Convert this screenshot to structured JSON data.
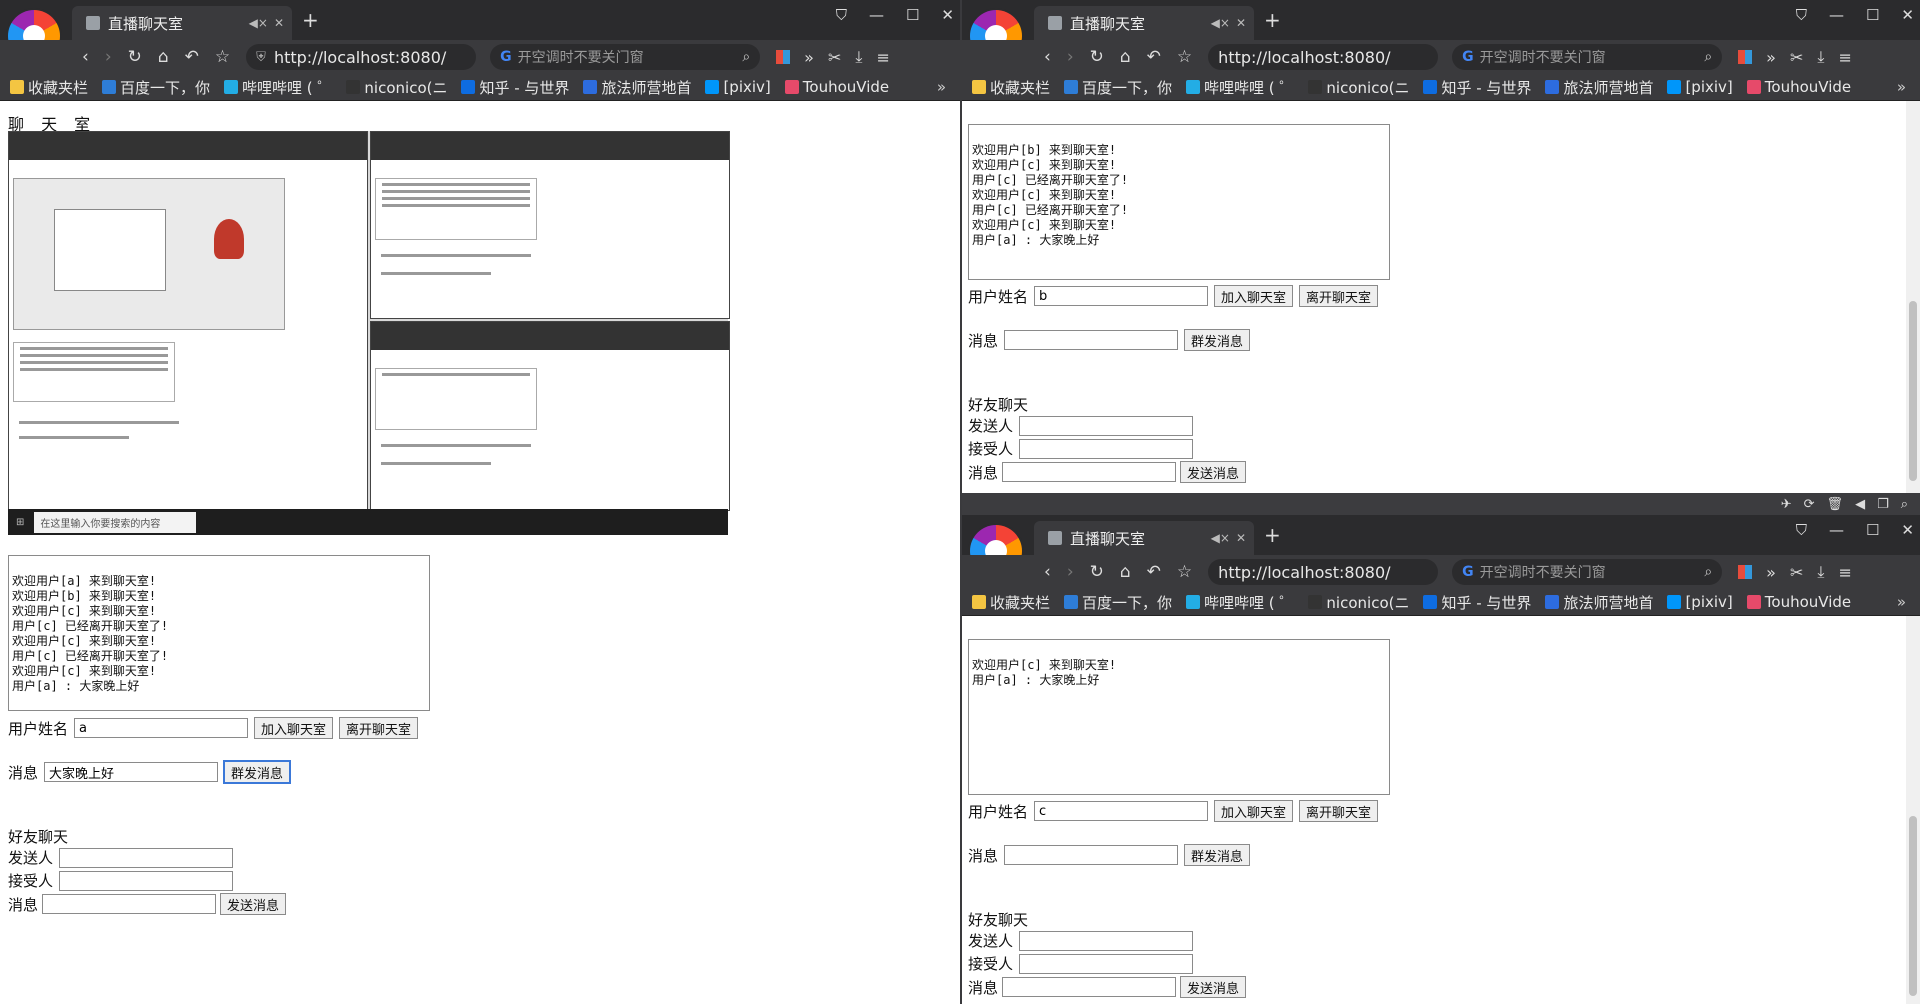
{
  "browser": {
    "tab_title": "直播聊天室",
    "mute_icon": "speaker-mute-icon",
    "url": "http://localhost:8080/",
    "search_placeholder": "开空调时不要关门窗",
    "bookmarks": [
      {
        "label": "收藏夹栏",
        "color": "#f4c542"
      },
      {
        "label": "百度一下，你",
        "color": "#2e7dd7"
      },
      {
        "label": "哔哩哔哩 ( ゜",
        "color": "#23ade5"
      },
      {
        "label": "niconico(ニ",
        "color": "#333333"
      },
      {
        "label": "知乎 - 与世界",
        "color": "#0e6ce0"
      },
      {
        "label": "旅法师营地首",
        "color": "#2d6cdf"
      },
      {
        "label": "[pixiv]",
        "color": "#0096fa"
      },
      {
        "label": "TouhouVide",
        "color": "#e64a6a"
      }
    ]
  },
  "left": {
    "page_title": "聊 天 室",
    "embedded_taskbar_search": "在这里输入你要搜索的内容",
    "chat_log": "欢迎用户[a] 来到聊天室!\n欢迎用户[b] 来到聊天室!\n欢迎用户[c] 来到聊天室!\n用户[c] 已经离开聊天室了!\n欢迎用户[c] 来到聊天室!\n用户[c] 已经离开聊天室了!\n欢迎用户[c] 来到聊天室!\n用户[a] : 大家晚上好",
    "username_label": "用户姓名",
    "username_value": "a",
    "join_label": "加入聊天室",
    "leave_label": "离开聊天室",
    "message_label": "消息",
    "message_value": "大家晚上好",
    "broadcast_label": "群发消息",
    "friend_title": "好友聊天",
    "sender_label": "发送人",
    "receiver_label": "接受人",
    "friend_message_label": "消息",
    "send_label": "发送消息"
  },
  "right_top": {
    "chat_log": "欢迎用户[b] 来到聊天室!\n欢迎用户[c] 来到聊天室!\n用户[c] 已经离开聊天室了!\n欢迎用户[c] 来到聊天室!\n用户[c] 已经离开聊天室了!\n欢迎用户[c] 来到聊天室!\n用户[a] : 大家晚上好",
    "username_label": "用户姓名",
    "username_value": "b",
    "join_label": "加入聊天室",
    "leave_label": "离开聊天室",
    "message_label": "消息",
    "message_value": "",
    "broadcast_label": "群发消息",
    "friend_title": "好友聊天",
    "sender_label": "发送人",
    "receiver_label": "接受人",
    "friend_message_label": "消息",
    "send_label": "发送消息"
  },
  "right_bottom": {
    "chat_log": "欢迎用户[c] 来到聊天室!\n用户[a] : 大家晚上好",
    "username_label": "用户姓名",
    "username_value": "c",
    "join_label": "加入聊天室",
    "leave_label": "离开聊天室",
    "message_label": "消息",
    "message_value": "",
    "broadcast_label": "群发消息",
    "friend_title": "好友聊天",
    "sender_label": "发送人",
    "receiver_label": "接受人",
    "friend_message_label": "消息",
    "send_label": "发送消息"
  },
  "snap_bar_icons": [
    "pin-icon",
    "refresh-icon",
    "trash-icon",
    "mute-icon",
    "window-icon",
    "search-icon"
  ]
}
